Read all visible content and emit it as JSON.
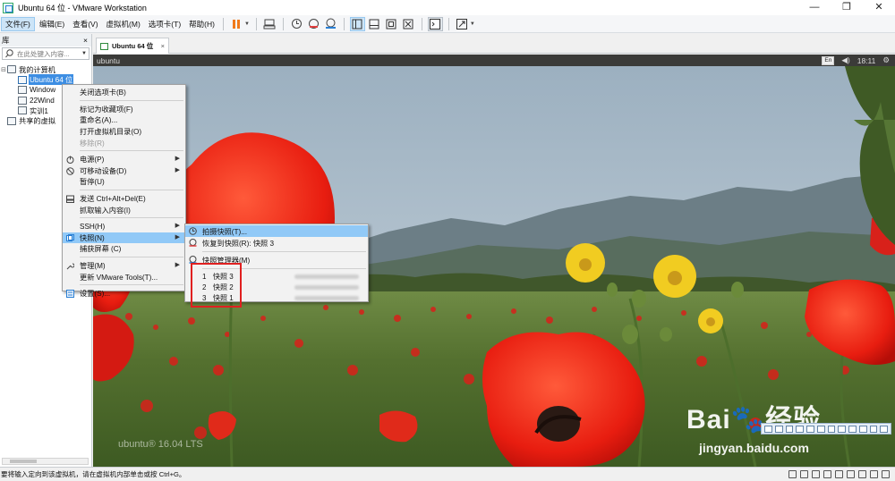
{
  "window": {
    "title": "Ubuntu 64 位 - VMware Workstation",
    "minimize": "—",
    "restore": "❐",
    "close": "✕"
  },
  "menubar": {
    "items": [
      "文件(F)",
      "编辑(E)",
      "查看(V)",
      "虚拟机(M)",
      "选项卡(T)",
      "帮助(H)"
    ]
  },
  "library": {
    "title": "库",
    "close": "×",
    "search_placeholder": "在此处键入内容...",
    "tree": {
      "root": "我的计算机",
      "vms": [
        "Ubuntu 64 位",
        "Window",
        "22Wind",
        "实训1"
      ],
      "shared": "共享的虚拟"
    }
  },
  "tab": {
    "label": "Ubuntu 64 位",
    "close": "×"
  },
  "vm": {
    "topbar_title": "ubuntu",
    "keyboard": "En",
    "volume": "◀)",
    "clock": "18:11",
    "power": "⚙",
    "watermark": "ubuntu® 16.04 LTS"
  },
  "context_menu": {
    "items": [
      {
        "label": "关闭选项卡(B)"
      },
      {
        "label": "标记为收藏项(F)"
      },
      {
        "label": "重命名(A)..."
      },
      {
        "label": "打开虚拟机目录(O)"
      },
      {
        "label": "移除(R)"
      },
      {
        "label": "电源(P)"
      },
      {
        "label": "可移动设备(D)"
      },
      {
        "label": "暂停(U)"
      },
      {
        "label": "发送 Ctrl+Alt+Del(E)"
      },
      {
        "label": "抓取输入内容(I)"
      },
      {
        "label": "SSH(H)"
      },
      {
        "label": "快照(N)"
      },
      {
        "label": "捕获屏幕 (C)"
      },
      {
        "label": "管理(M)"
      },
      {
        "label": "更新 VMware Tools(T)..."
      },
      {
        "label": "设置(S)..."
      }
    ]
  },
  "snapshot_submenu": {
    "take": "拍摄快照(T)...",
    "revert": "恢复到快照(R): 快照 3",
    "manager": "快照管理器(M)",
    "snapshots": [
      {
        "num": "1",
        "name": "快照 3"
      },
      {
        "num": "2",
        "name": "快照 2"
      },
      {
        "num": "3",
        "name": "快照 1"
      }
    ]
  },
  "statusbar": {
    "text": "要将输入定向到该虚拟机，请在虚拟机内部单击或按 Ctrl+G。"
  },
  "watermark": {
    "brand": "Bai🐾经验",
    "url": "jingyan.baidu.com"
  },
  "colors": {
    "accent": "#3d8ee3",
    "menu_highlight": "#91c9f7",
    "annotation_box": "#e02020",
    "power_orange": "#f07a1a"
  }
}
